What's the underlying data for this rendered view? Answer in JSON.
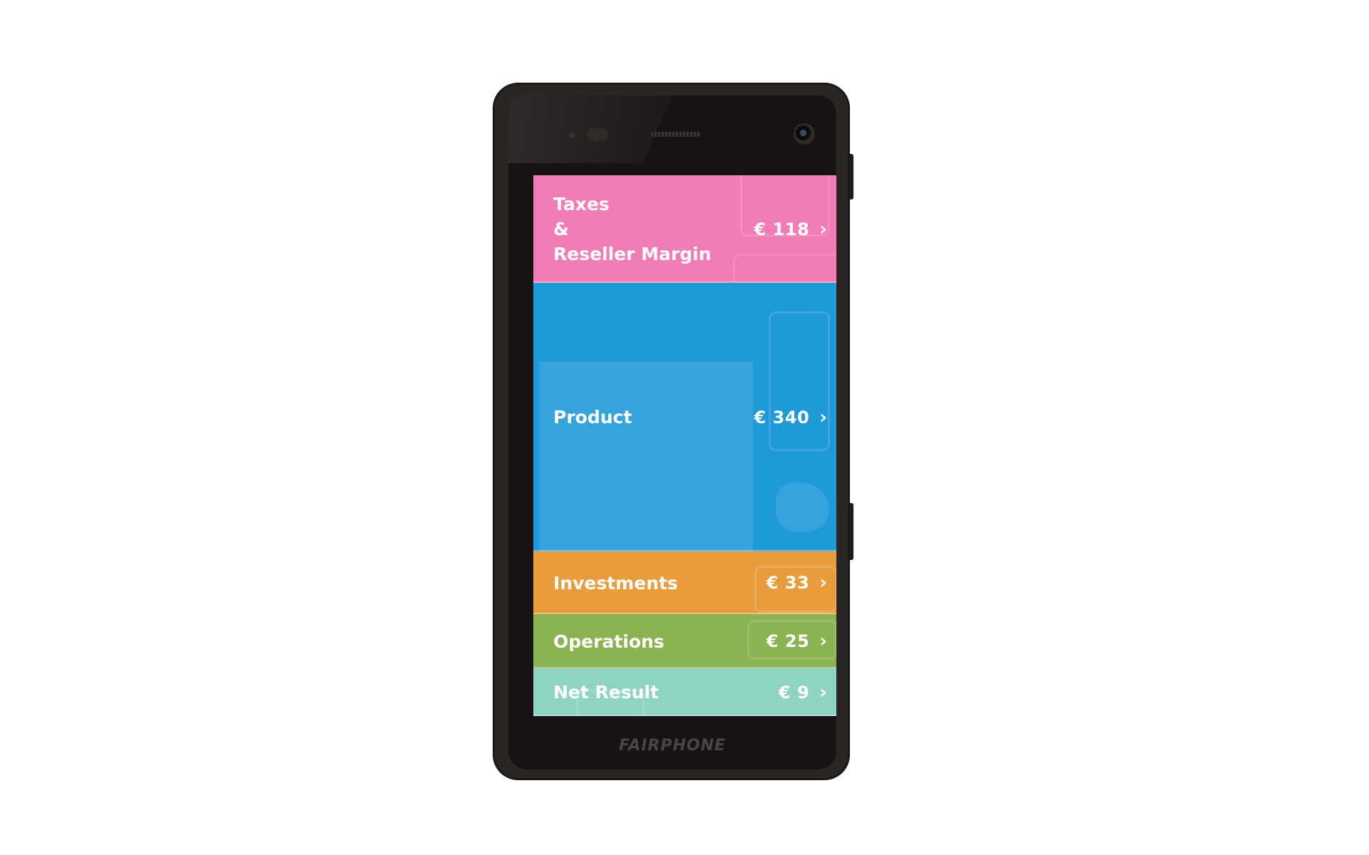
{
  "brand": "FAIRPHONE",
  "rows": [
    {
      "key": "taxes",
      "label_lines": [
        "Taxes",
        "&",
        "Reseller Margin"
      ],
      "value": "€ 118",
      "share": 118,
      "color": "#f27db6"
    },
    {
      "key": "product",
      "label_lines": [
        "Product"
      ],
      "value": "€ 340",
      "share": 340,
      "color": "#1f9ad9"
    },
    {
      "key": "investments",
      "label_lines": [
        "Investments"
      ],
      "value": "€ 33",
      "share": 33,
      "color": "#e89c3c"
    },
    {
      "key": "operations",
      "label_lines": [
        "Operations"
      ],
      "value": "€ 25",
      "share": 25,
      "color": "#8cb352"
    },
    {
      "key": "net-result",
      "label_lines": [
        "Net Result"
      ],
      "value": "€ 9",
      "share": 9,
      "color": "#8fd3c2"
    }
  ],
  "chevron_icon": "chevron-right-icon"
}
